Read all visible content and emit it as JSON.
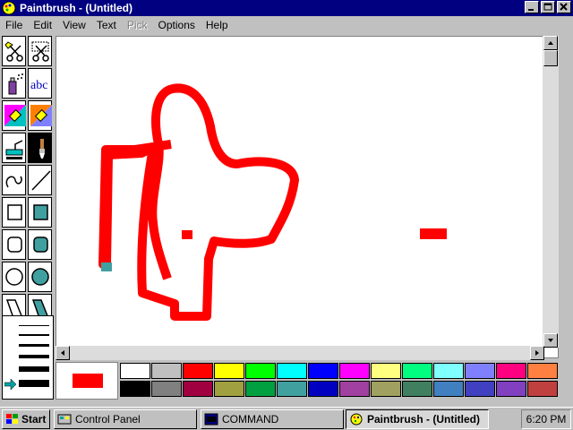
{
  "window": {
    "title": "Paintbrush - (Untitled)",
    "icon": "paintbrush-icon"
  },
  "menu": [
    "File",
    "Edit",
    "View",
    "Text",
    "Pick",
    "Options",
    "Help"
  ],
  "menu_disabled": [
    "Pick"
  ],
  "toolbox": {
    "tools": [
      "scissors-icon",
      "pick-scissors-icon",
      "airbrush-icon",
      "text-tool-icon",
      "color-eraser-icon",
      "eraser-icon",
      "paint-roller-icon",
      "brush-icon",
      "curve-icon",
      "line-icon",
      "box-icon",
      "filled-box-icon",
      "rounded-box-icon",
      "filled-rounded-box-icon",
      "circle-icon",
      "filled-circle-icon",
      "polygon-icon",
      "filled-polygon-icon"
    ],
    "text_tool_label": "abc"
  },
  "palette": {
    "foreground": "#ff0000",
    "background": "#ffffff",
    "colors_top": [
      "#ffffff",
      "#c0c0c0",
      "#ff0000",
      "#ffff00",
      "#00ff00",
      "#00ffff",
      "#0000ff",
      "#ff00ff",
      "#ffff80",
      "#00ff80",
      "#80ffff",
      "#8080ff",
      "#ff0080",
      "#ff8040"
    ],
    "colors_bottom": [
      "#000000",
      "#808080",
      "#a00040",
      "#a0a040",
      "#00a040",
      "#40a0a0",
      "#0000c0",
      "#a040a0",
      "#a0a060",
      "#408060",
      "#4080c0",
      "#4040c0",
      "#8040c0",
      "#c04040"
    ]
  },
  "taskbar": {
    "start": "Start",
    "buttons": [
      "Control Panel",
      "COMMAND",
      "Paintbrush - (Untitled)"
    ],
    "clock": "6:20 PM"
  }
}
